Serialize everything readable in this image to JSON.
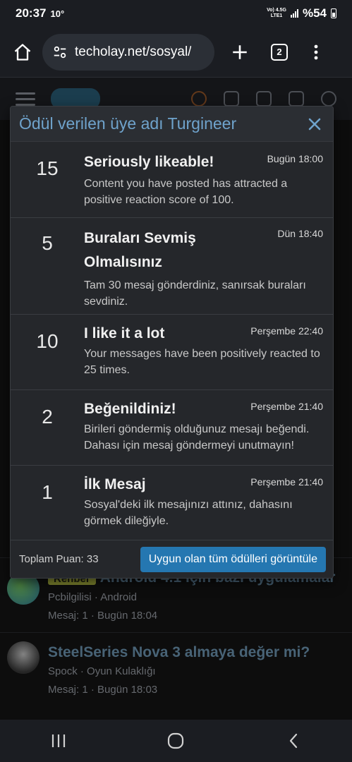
{
  "status_bar": {
    "time": "20:37",
    "temp": "10°",
    "network_top": "Vo) 4.5G",
    "network_bottom": "LTE1",
    "battery": "%54"
  },
  "browser": {
    "url": "techolay.net/sosyal/",
    "tab_count": "2"
  },
  "modal": {
    "title": "Ödül verilen üye adı Turgineer",
    "trophies": [
      {
        "points": "15",
        "title": "Seriously likeable!",
        "date": "Bugün 18:00",
        "description": "Content you have posted has attracted a positive reaction score of 100."
      },
      {
        "points": "5",
        "title": "Buraları Sevmiş Olmalısınız",
        "date": "Dün 18:40",
        "description": "Tam 30 mesaj gönderdiniz, sanırsak buraları sevdiniz."
      },
      {
        "points": "10",
        "title": "I like it a lot",
        "date": "Perşembe 22:40",
        "description": "Your messages have been positively reacted to 25 times."
      },
      {
        "points": "2",
        "title": "Beğenildiniz!",
        "date": "Perşembe 21:40",
        "description": "Birileri göndermiş olduğunuz mesajı beğendi. Dahası için mesaj göndermeyi unutmayın!"
      },
      {
        "points": "1",
        "title": "İlk Mesaj",
        "date": "Perşembe 21:40",
        "description": "Sosyal'deki ilk mesajınızı attınız, dahasını görmek dileğiyle."
      }
    ],
    "total_label": "Toplam Puan: 33",
    "view_all_label": "Uygun olan tüm ödülleri görüntüle"
  },
  "threads": [
    {
      "prefix": "Rehber",
      "title": "Android 4.1 için bazı uygulamalar",
      "author": "Pcbilgilisi",
      "forum": "Android",
      "replies": "Mesaj: 1",
      "time": "Bugün 18:04"
    },
    {
      "title": "SteelSeries Nova 3 almaya değer mi?",
      "author": "Spock",
      "forum": "Oyun Kulaklığı",
      "replies": "Mesaj: 1",
      "time": "Bugün 18:03"
    }
  ],
  "colors": {
    "accent": "#2577b1",
    "title_link": "#6fa3cc",
    "thread_link": "#6f98b6"
  }
}
